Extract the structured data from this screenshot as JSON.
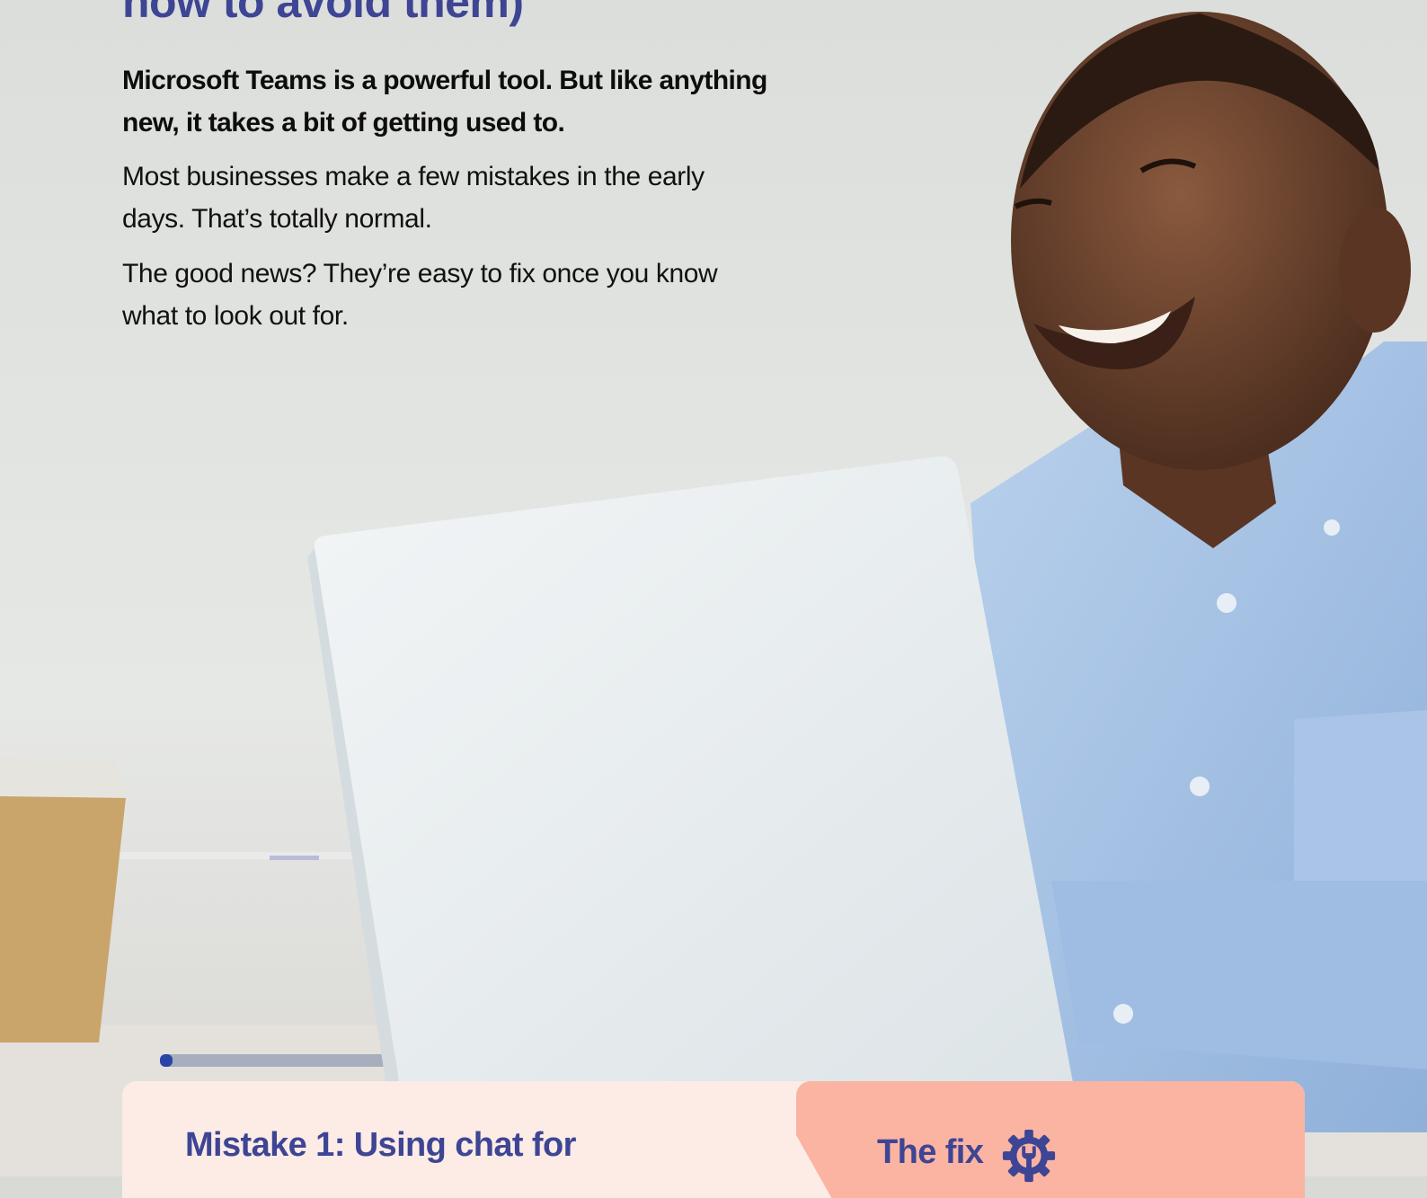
{
  "article": {
    "headline": "how to avoid them)",
    "lead": "Microsoft Teams is a powerful tool. But like anything new, it takes a bit of getting used to.",
    "paragraph_1": "Most businesses make a few mistakes in the early days. That’s totally normal.",
    "paragraph_2": "The good news? They’re easy to fix once you know what to look out for."
  },
  "mistake_card": {
    "title": "Mistake 1: Using chat for",
    "fix_label": "The fix",
    "fix_icon": "gear-wrench-icon"
  },
  "colors": {
    "brand": "#3d4594",
    "card_background": "#fdebe6",
    "fix_background": "#fbb3a2"
  }
}
